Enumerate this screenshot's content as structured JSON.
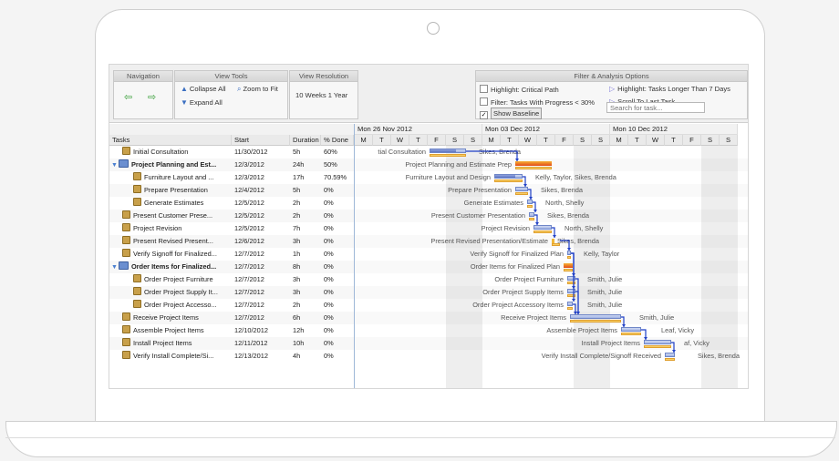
{
  "toolbar": {
    "navigation": {
      "title": "Navigation",
      "back": "⇦",
      "forward": "⇨"
    },
    "view_tools": {
      "title": "View Tools",
      "collapse_all": "Collapse All",
      "zoom_to_fit": "Zoom to Fit",
      "expand_all": "Expand All"
    },
    "view_resolution": {
      "title": "View Resolution",
      "value": "10 Weeks   1 Year"
    },
    "filter": {
      "title": "Filter & Analysis Options",
      "highlight_critical": "Highlight: Critical Path",
      "highlight_longer": "Highlight: Tasks Longer Than 7 Days",
      "filter_progress": "Filter: Tasks With Progress < 30%",
      "scroll_last": "Scroll To Last Task",
      "show_baseline": "Show Baseline",
      "show_baseline_checked": "✓",
      "search_placeholder": "Search for task..."
    }
  },
  "columns": {
    "tasks": "Tasks",
    "start": "Start",
    "duration": "Duration",
    "done": "% Done"
  },
  "timeline": {
    "weeks": [
      "Mon 26 Nov 2012",
      "Mon 03 Dec 2012",
      "Mon 10 Dec 2012"
    ],
    "days": [
      "M",
      "T",
      "W",
      "T",
      "F",
      "S",
      "S",
      "M",
      "T",
      "W",
      "T",
      "F",
      "S",
      "S",
      "M",
      "T",
      "W",
      "T",
      "F",
      "S",
      "S"
    ]
  },
  "tasks": [
    {
      "name": "Initial Consultation",
      "start": "11/30/2012",
      "duration": "5h",
      "done": "60%"
    },
    {
      "name": "Project Planning and Est...",
      "start": "12/3/2012",
      "duration": "24h",
      "done": "50%"
    },
    {
      "name": "Furniture Layout and ...",
      "start": "12/3/2012",
      "duration": "17h",
      "done": "70.59%"
    },
    {
      "name": "Prepare Presentation",
      "start": "12/4/2012",
      "duration": "5h",
      "done": "0%"
    },
    {
      "name": "Generate Estimates",
      "start": "12/5/2012",
      "duration": "2h",
      "done": "0%"
    },
    {
      "name": "Present Customer Prese...",
      "start": "12/5/2012",
      "duration": "2h",
      "done": "0%"
    },
    {
      "name": "Project Revision",
      "start": "12/5/2012",
      "duration": "7h",
      "done": "0%"
    },
    {
      "name": "Present Revised Present...",
      "start": "12/6/2012",
      "duration": "3h",
      "done": "0%"
    },
    {
      "name": "Verify Signoff for Finalized...",
      "start": "12/7/2012",
      "duration": "1h",
      "done": "0%"
    },
    {
      "name": "Order Items for Finalized...",
      "start": "12/7/2012",
      "duration": "8h",
      "done": "0%"
    },
    {
      "name": "Order Project Furniture",
      "start": "12/7/2012",
      "duration": "3h",
      "done": "0%"
    },
    {
      "name": "Order Project Supply It...",
      "start": "12/7/2012",
      "duration": "3h",
      "done": "0%"
    },
    {
      "name": "Order Project Accesso...",
      "start": "12/7/2012",
      "duration": "2h",
      "done": "0%"
    },
    {
      "name": "Receive Project Items",
      "start": "12/7/2012",
      "duration": "6h",
      "done": "0%"
    },
    {
      "name": "Assemble Project Items",
      "start": "12/10/2012",
      "duration": "12h",
      "done": "0%"
    },
    {
      "name": "Install Project Items",
      "start": "12/11/2012",
      "duration": "10h",
      "done": "0%"
    },
    {
      "name": "Verify Install Complete/Si...",
      "start": "12/13/2012",
      "duration": "4h",
      "done": "0%"
    }
  ],
  "gantt_labels": [
    {
      "left": "tial Consultation",
      "right": "Sikes, Brenda"
    },
    {
      "left": "Project Planning and Estimate Prep",
      "right": ""
    },
    {
      "left": "Furniture Layout and Design",
      "right": "Kelly, Taylor, Sikes, Brenda"
    },
    {
      "left": "Prepare Presentation",
      "right": "Sikes, Brenda"
    },
    {
      "left": "Generate Estimates",
      "right": "North, Shelly"
    },
    {
      "left": "Present Customer Presentation",
      "right": "Sikes, Brenda"
    },
    {
      "left": "Project Revision",
      "right": "North, Shelly"
    },
    {
      "left": "Present Revised Presentation/Estimate",
      "right": "Sikes, Brenda"
    },
    {
      "left": "Verify Signoff for Finalized Plan",
      "right": "Kelly, Taylor"
    },
    {
      "left": "Order Items for Finalized Plan",
      "right": ""
    },
    {
      "left": "Order Project Furniture",
      "right": "Smith, Julie"
    },
    {
      "left": "Order Project Supply Items",
      "right": "Smith, Julie"
    },
    {
      "left": "Order Project Accessory Items",
      "right": "Smith, Julie"
    },
    {
      "left": "Receive Project Items",
      "right": "Smith, Julie"
    },
    {
      "left": "Assemble Project Items",
      "right": "Leaf, Vicky"
    },
    {
      "left": "Install Project Items",
      "right": "af, Vicky"
    },
    {
      "left": "Verify Install Complete/Signoff Received",
      "right": "Sikes, Brenda"
    }
  ]
}
